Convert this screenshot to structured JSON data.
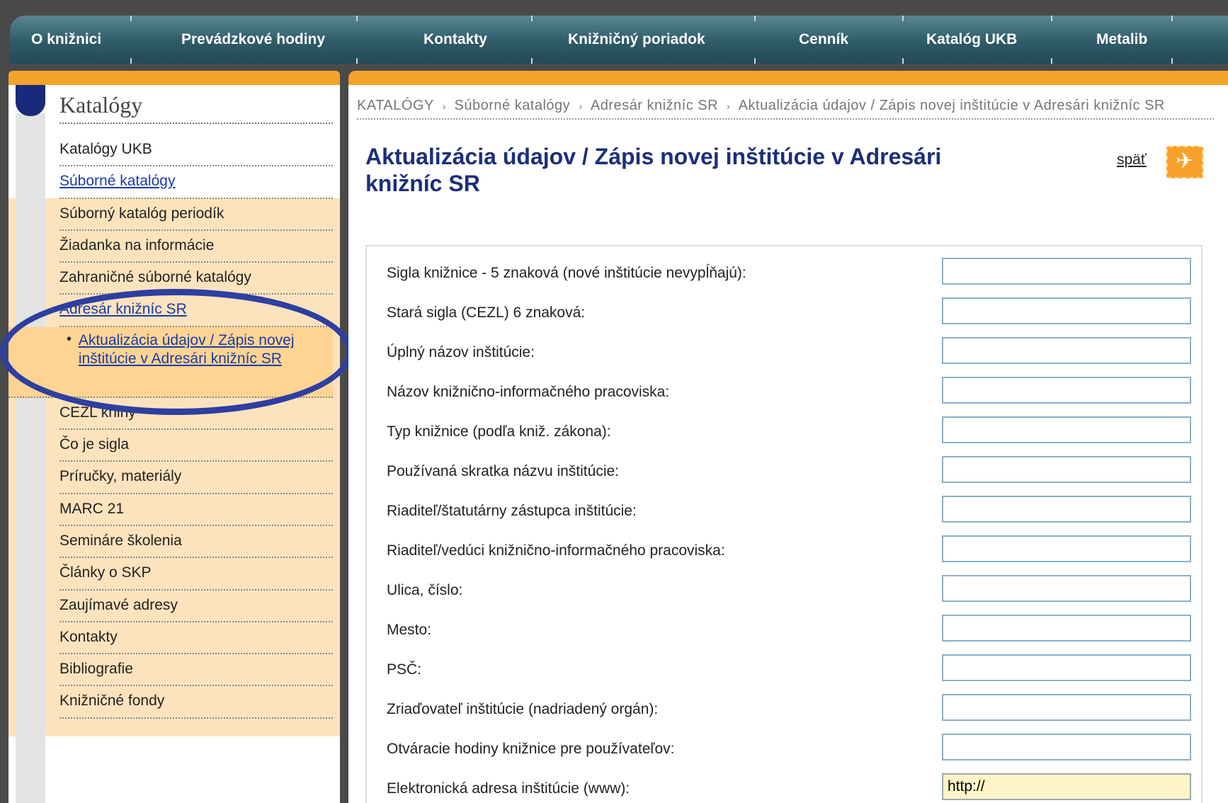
{
  "topnav": {
    "items": [
      "O knižnici",
      "Prevádzkové hodiny",
      "Kontakty",
      "Knižničný poriadok",
      "Cenník",
      "Katalóg UKB",
      "Metalib"
    ]
  },
  "sidebar": {
    "title": "Katalógy",
    "items": [
      {
        "label": "Katalógy UKB"
      },
      {
        "label": "Súborné katalógy"
      },
      {
        "label": "Súborný katalóg periodík"
      },
      {
        "label": "Žiadanka na informácie"
      },
      {
        "label": "Zahraničné súborné katalógy"
      },
      {
        "label": "Adresár knižníc SR"
      },
      {
        "label": "Aktualizácia údajov / Zápis novej inštitúcie v Adresári knižníc SR"
      },
      {
        "label": "CEZL knihy"
      },
      {
        "label": "Čo je sigla"
      },
      {
        "label": "Príručky, materiály"
      },
      {
        "label": "MARC 21"
      },
      {
        "label": "Semináre školenia"
      },
      {
        "label": "Články o SKP"
      },
      {
        "label": "Zaujímavé adresy"
      },
      {
        "label": "Kontakty"
      },
      {
        "label": "Bibliografie"
      },
      {
        "label": "Knižničné fondy"
      }
    ]
  },
  "breadcrumb": {
    "items": [
      "KATALÓGY",
      "Súborné katalógy",
      "Adresár knižníc SR",
      "Aktualizácia údajov / Zápis novej inštitúcie v Adresári knižníc SR"
    ],
    "separator": "›"
  },
  "main": {
    "title": "Aktualizácia údajov / Zápis novej inštitúcie v Adresári knižníc SR",
    "back_label": "späť"
  },
  "form": {
    "fields": [
      {
        "label": "Sigla knižnice - 5 znaková (nové inštitúcie nevypĺňajú):",
        "value": ""
      },
      {
        "label": "Stará sigla (CEZL) 6 znaková:",
        "value": ""
      },
      {
        "label": "Úplný názov inštitúcie:",
        "value": ""
      },
      {
        "label": "Názov knižnično-informačného pracoviska:",
        "value": ""
      },
      {
        "label": "Typ knižnice (podľa kniž. zákona):",
        "value": ""
      },
      {
        "label": "Používaná skratka názvu inštitúcie:",
        "value": ""
      },
      {
        "label": "Riaditeľ/štatutárny zástupca inštitúcie:",
        "value": ""
      },
      {
        "label": "Riaditeľ/vedúci knižnično-informačného pracoviska:",
        "value": ""
      },
      {
        "label": "Ulica, číslo:",
        "value": ""
      },
      {
        "label": "Mesto:",
        "value": ""
      },
      {
        "label": "PSČ:",
        "value": ""
      },
      {
        "label": "Zriaďovateľ inštitúcie (nadriadený orgán):",
        "value": ""
      },
      {
        "label": "Otváracie hodiny knižnice pre používateľov:",
        "value": ""
      },
      {
        "label": "Elektronická adresa inštitúcie (www):",
        "value": "http://"
      }
    ]
  },
  "colors": {
    "nav": "#2f5a67",
    "accent_orange": "#f5a32b",
    "title_blue": "#1b2f7a",
    "annotation_ellipse": "#2d3fa0"
  }
}
